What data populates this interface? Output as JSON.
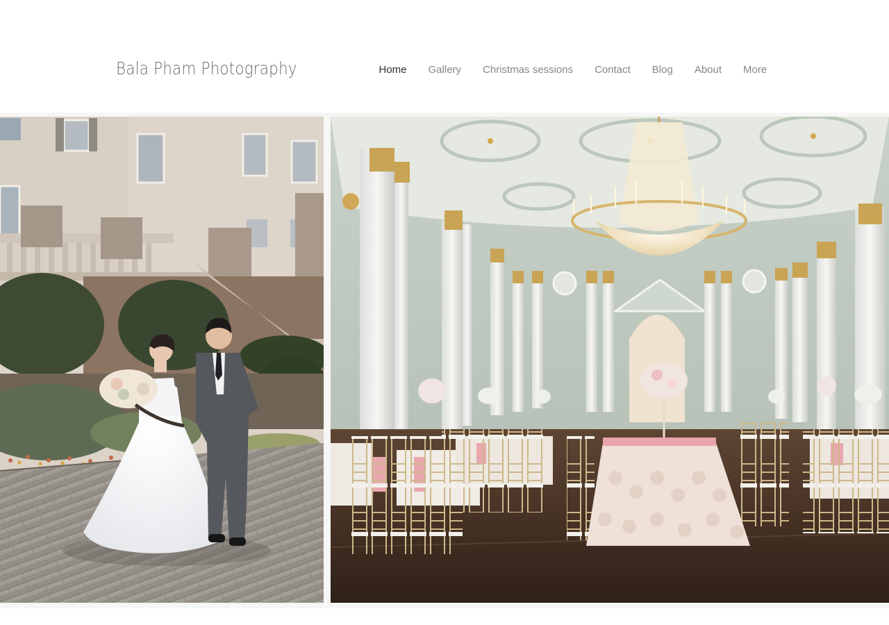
{
  "site": {
    "title": "Bala Pham Photography"
  },
  "nav": {
    "items": [
      {
        "label": "Home",
        "active": true
      },
      {
        "label": "Gallery",
        "active": false
      },
      {
        "label": "Christmas sessions",
        "active": false
      },
      {
        "label": "Contact",
        "active": false
      },
      {
        "label": "Blog",
        "active": false
      },
      {
        "label": "About",
        "active": false
      },
      {
        "label": "More",
        "active": false
      }
    ]
  },
  "gallery": {
    "images": [
      {
        "subject": "bride-and-groom-on-brick-courtyard"
      },
      {
        "subject": "ballroom-reception-with-chandelier"
      }
    ]
  },
  "colors": {
    "title": "#6b6b6b",
    "nav_active": "#2f2f2f",
    "nav_inactive": "#8a8680",
    "band": "#f6f6f6"
  }
}
